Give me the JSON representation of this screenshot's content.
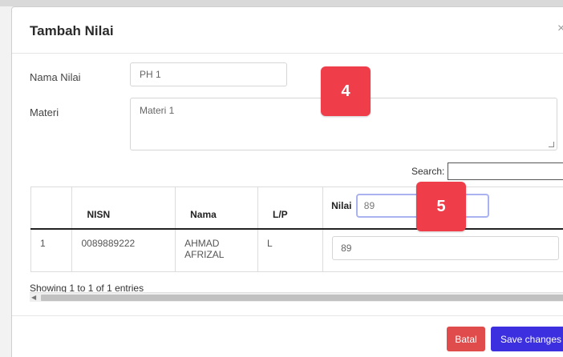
{
  "modal": {
    "title": "Tambah Nilai",
    "close_icon": "×"
  },
  "form": {
    "nama_label": "Nama Nilai",
    "nama_value": "PH 1",
    "materi_label": "Materi",
    "materi_value": "Materi 1"
  },
  "annotations": [
    "4",
    "5"
  ],
  "table": {
    "search_label": "Search:",
    "headers": [
      "",
      "NISN",
      "Nama",
      "L/P",
      "Nilai"
    ],
    "nilai_header_input": "89",
    "rows": [
      {
        "no": "1",
        "nisn": "0089889222",
        "nama_line1": "AHMAD",
        "nama_line2": "AFRIZAL",
        "lp": "L",
        "nilai": "89"
      }
    ],
    "info": "Showing 1 to 1 of 1 entries"
  },
  "footer": {
    "cancel_label": "Batal",
    "save_label": "Save changes"
  },
  "colors": {
    "danger": "#e04b4b",
    "primary": "#3b2fe0",
    "badge": "#ef3e4a"
  },
  "icons": [
    "close-icon",
    "resize-grip-icon",
    "scroll-left-icon",
    "scroll-right-icon"
  ]
}
